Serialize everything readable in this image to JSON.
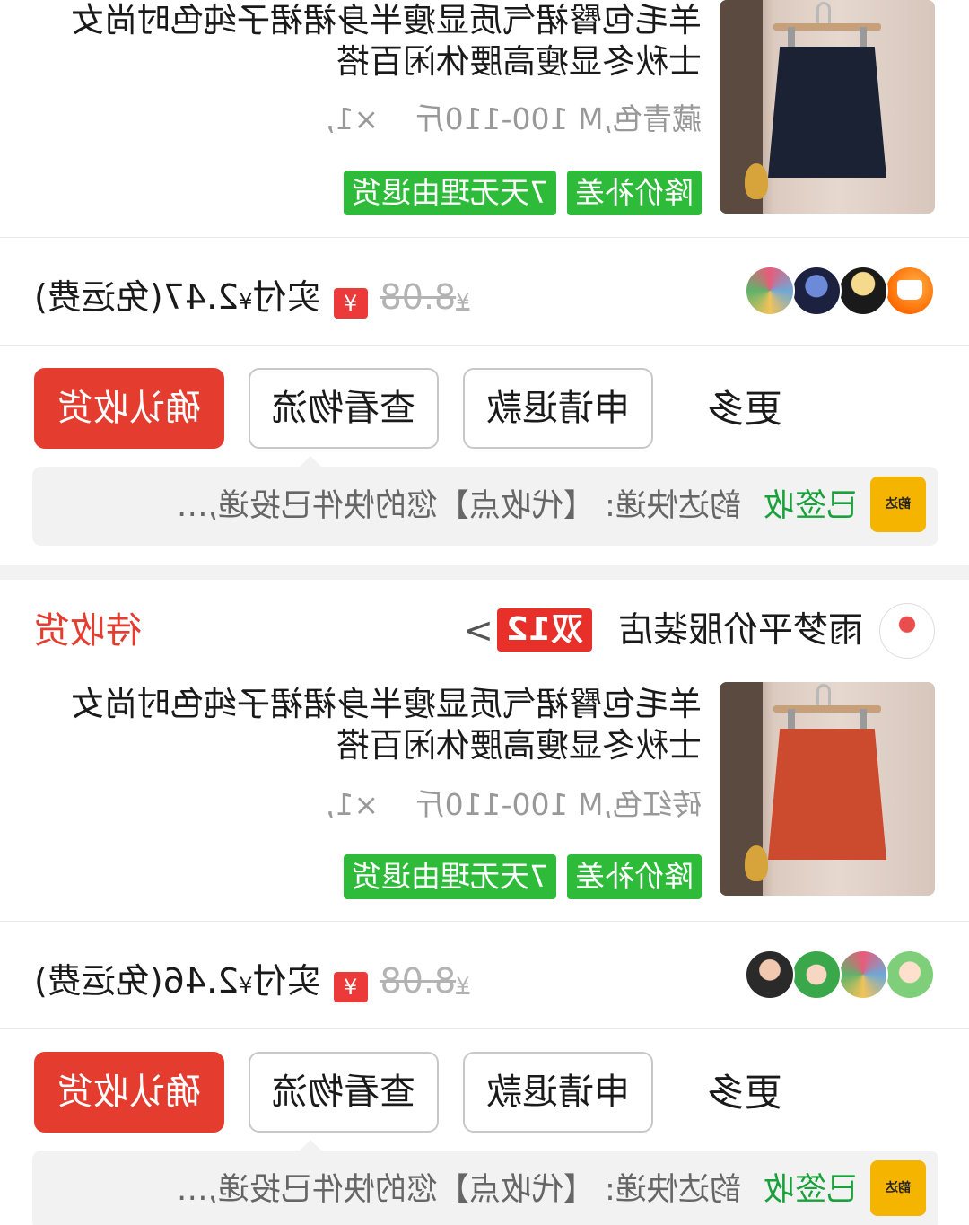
{
  "orders": [
    {
      "shop": null,
      "item": {
        "title": "羊毛包臀裙气质显瘦半身裙裙子纯色时尚女士秋冬显瘦高腰休闲百搭",
        "spec": "藏青色,M 100-110斤",
        "qty": "×1,",
        "tags": [
          "降价补差",
          "7天无理由退货"
        ],
        "skirt_color": "#1b2233"
      },
      "price": {
        "original_symbol": "¥",
        "original": "8.08",
        "badge": "¥",
        "paid_label": "实付",
        "paid_symbol": "¥",
        "paid": "2.47",
        "shipping_note": "(免运费)"
      },
      "actions": {
        "more": "更多",
        "refund": "申请退款",
        "logistics": "查看物流",
        "confirm": "确认收货"
      },
      "logistics": {
        "carrier_logo_text": "韵达",
        "signed": "已签收",
        "text": "韵达快递: 【代收点】您的快件已投递,…"
      }
    },
    {
      "shop": {
        "name": "雨梦平价服装店",
        "badge": "双12",
        "chevron": ">",
        "status": "待收货"
      },
      "item": {
        "title": "羊毛包臀裙气质显瘦半身裙裙子纯色时尚女士秋冬显瘦高腰休闲百搭",
        "spec": "砖红色,M 100-110斤",
        "qty": "×1,",
        "tags": [
          "降价补差",
          "7天无理由退货"
        ],
        "skirt_color": "#cc4a2e"
      },
      "price": {
        "original_symbol": "¥",
        "original": "8.08",
        "badge": "¥",
        "paid_label": "实付",
        "paid_symbol": "¥",
        "paid": "2.46",
        "shipping_note": "(免运费)"
      },
      "actions": {
        "more": "更多",
        "refund": "申请退款",
        "logistics": "查看物流",
        "confirm": "确认收货"
      },
      "logistics": {
        "carrier_logo_text": "韵达",
        "signed": "已签收",
        "text": "韵达快递: 【代收点】您的快件已投递,…"
      }
    }
  ],
  "colors": {
    "accent_red": "#e43c2f",
    "tag_green": "#2ebb3a",
    "signed_green": "#19a13b"
  }
}
